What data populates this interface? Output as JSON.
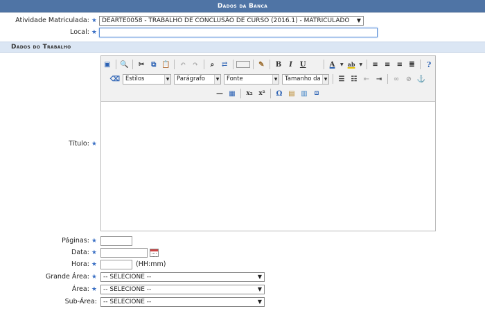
{
  "header": {
    "title": "Dados da Banca"
  },
  "atividade": {
    "label": "Atividade Matriculada:",
    "selected": "DEARTE0058 - TRABALHO DE CONCLUSÃO DE CURSO (2016.1) - MATRICULADO"
  },
  "local": {
    "label": "Local:",
    "value": ""
  },
  "section": {
    "title": "Dados do Trabalho"
  },
  "titulo": {
    "label": "Título:"
  },
  "editor_toolbar": {
    "styles_combo": "Estilos",
    "format_combo": "Parágrafo",
    "font_combo": "Fonte",
    "size_combo": "Tamanho da F"
  },
  "paginas": {
    "label": "Páginas:",
    "value": ""
  },
  "data": {
    "label": "Data:",
    "value": ""
  },
  "hora": {
    "label": "Hora:",
    "value": "",
    "hint": "(HH:mm)"
  },
  "grande_area": {
    "label": "Grande Área:",
    "selected": "-- SELECIONE --"
  },
  "area": {
    "label": "Área:",
    "selected": "-- SELECIONE --"
  },
  "sub_area": {
    "label": "Sub-Área:",
    "selected": "-- SELECIONE --"
  },
  "required_marker": "★",
  "colors": {
    "header_bg": "#4f74a5",
    "section_bg": "#dbe6f4",
    "required": "#3a6fc4"
  }
}
